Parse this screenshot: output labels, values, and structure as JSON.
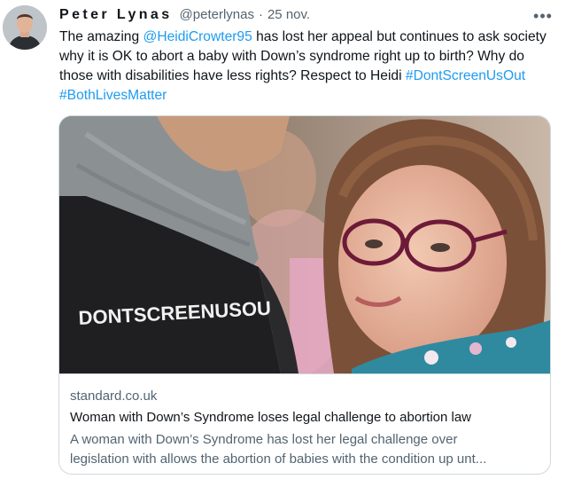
{
  "tweet": {
    "author_name": "Peter Lynas",
    "handle": "@peterlynas",
    "separator": "·",
    "timestamp": "25 nov.",
    "more_icon": "more-horizontal-icon",
    "text": {
      "part1": "The amazing ",
      "mention": "@HeidiCrowter95",
      "part2": " has lost her appeal but continues to ask society why it is OK to abort a baby with Down’s syndrome right up to birth? Why do those with disabilities have less rights? Respect to Heidi ",
      "hashtag1": "#DontScreenUsOut",
      "space": " ",
      "hashtag2": "#BothLivesMatter"
    }
  },
  "link_card": {
    "shirt_text": "DONTSCREENUSOU",
    "domain": "standard.co.uk",
    "title": "Woman with Down’s Syndrome loses legal challenge to abortion law",
    "description_line1": "A woman with Down’s Syndrome has lost her legal challenge over",
    "description_line2": "legislation with allows the abortion of babies with the condition up unt..."
  },
  "colors": {
    "link": "#1d9bf0",
    "text": "#0f1419",
    "secondary": "#536471",
    "border": "#cfd9de"
  }
}
